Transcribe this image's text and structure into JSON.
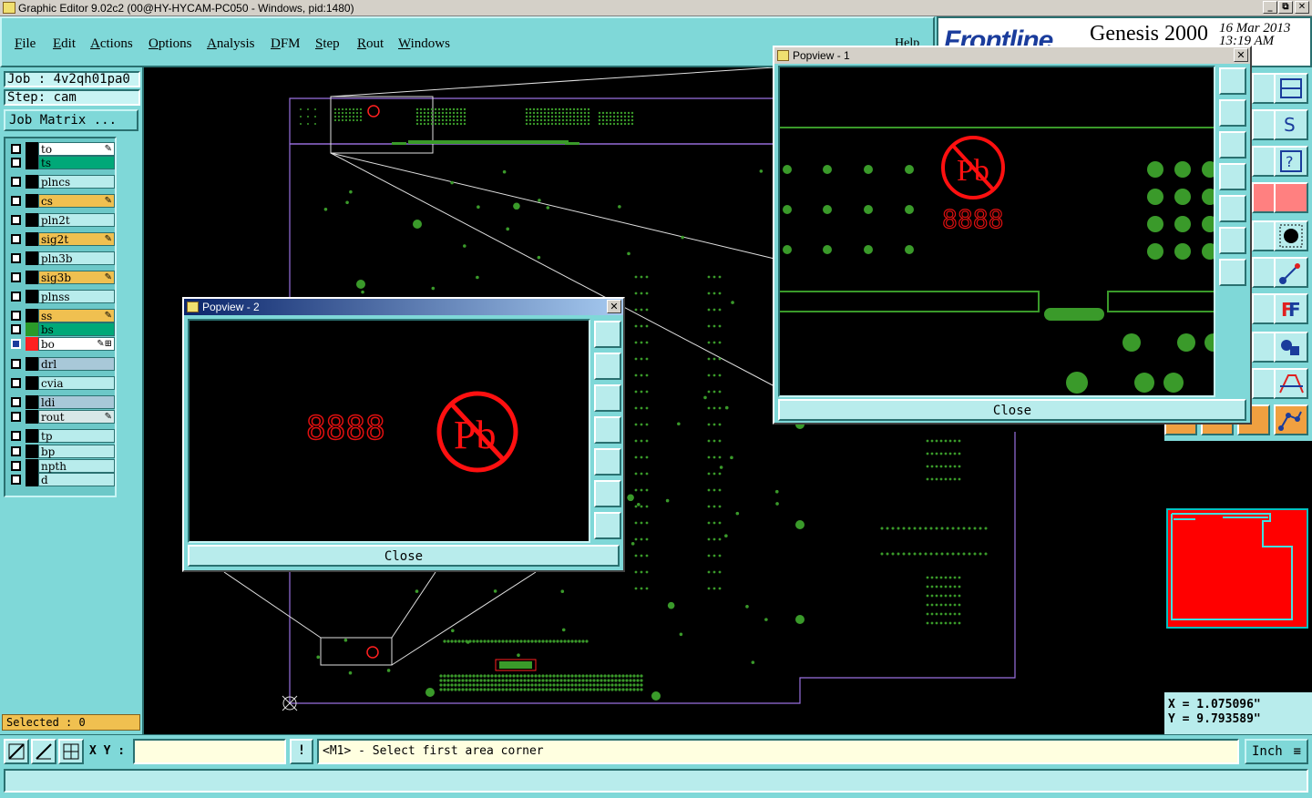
{
  "window": {
    "title": "Graphic Editor 9.02c2 (00@HY-HYCAM-PC050 - Windows, pid:1480)",
    "btn_min": "_",
    "btn_max": "⧉",
    "btn_close": "✕"
  },
  "menu": {
    "items": [
      "File",
      "Edit",
      "Actions",
      "Options",
      "Analysis",
      "DFM",
      "Step",
      "Rout",
      "Windows"
    ],
    "help": "Help"
  },
  "brand": {
    "logo": "Frontline",
    "product": "Genesis 2000",
    "date": "16 Mar 2013",
    "time": "13:19 AM"
  },
  "job": {
    "job_label": "Job : 4v2qh01pa0",
    "step_label": "Step: cam",
    "matrix_button": "Job Matrix ..."
  },
  "layers": [
    {
      "name": "to",
      "bg": "#ffffff",
      "swatch": "#000000",
      "mark": "✎"
    },
    {
      "name": "ts",
      "bg": "#00a878",
      "swatch": "#000000",
      "mark": ""
    },
    {
      "name": "plncs",
      "bg": "#b8ecec",
      "swatch": "#000000",
      "mark": ""
    },
    {
      "name": "cs",
      "bg": "#f0c050",
      "swatch": "#000000",
      "mark": "✎"
    },
    {
      "name": "pln2t",
      "bg": "#b8ecec",
      "swatch": "#000000",
      "mark": ""
    },
    {
      "name": "sig2t",
      "bg": "#f0c050",
      "swatch": "#000000",
      "mark": "✎"
    },
    {
      "name": "pln3b",
      "bg": "#b8ecec",
      "swatch": "#000000",
      "mark": ""
    },
    {
      "name": "sig3b",
      "bg": "#f0c050",
      "swatch": "#000000",
      "mark": "✎"
    },
    {
      "name": "plnss",
      "bg": "#b8ecec",
      "swatch": "#000000",
      "mark": ""
    },
    {
      "name": "ss",
      "bg": "#f0c050",
      "swatch": "#000000",
      "mark": "✎"
    },
    {
      "name": "bs",
      "bg": "#00a878",
      "swatch": "#2a9a2a",
      "mark": ""
    },
    {
      "name": "bo",
      "bg": "#ffffff",
      "swatch": "#ff2020",
      "mark": "✎⊞"
    },
    {
      "name": "drl",
      "bg": "#a8c8d8",
      "swatch": "#000000",
      "mark": ""
    },
    {
      "name": "cvia",
      "bg": "#b8ecec",
      "swatch": "#000000",
      "mark": ""
    },
    {
      "name": "ldi",
      "bg": "#a8c8d8",
      "swatch": "#000000",
      "mark": ""
    },
    {
      "name": "rout",
      "bg": "#d8e8e8",
      "swatch": "#000000",
      "mark": "✎"
    },
    {
      "name": "tp",
      "bg": "#b8ecec",
      "swatch": "#000000",
      "mark": ""
    },
    {
      "name": "bp",
      "bg": "#b8ecec",
      "swatch": "#000000",
      "mark": ""
    },
    {
      "name": "npth",
      "bg": "#b8ecec",
      "swatch": "#000000",
      "mark": ""
    },
    {
      "name": "d",
      "bg": "#b8ecec",
      "swatch": "#000000",
      "mark": ""
    }
  ],
  "selected": "Selected : 0",
  "popview1": {
    "title": "Popview - 1",
    "close": "Close",
    "digits": "8888",
    "symbol": "Pb"
  },
  "popview2": {
    "title": "Popview - 2",
    "close": "Close",
    "digits": "8888",
    "symbol": "Pb"
  },
  "coords": {
    "x": "X = 1.075096\"",
    "y": "Y = 9.793589\""
  },
  "bottom": {
    "xy_label": "X Y :",
    "xy_value": "",
    "excl": "!",
    "prompt": "<M1> - Select first area corner",
    "unit": "Inch"
  },
  "colors": {
    "pad_green": "#3a9a2a",
    "outline": "#9a70e0",
    "accent_red": "#ff0000",
    "panel": "#7fd8d8"
  }
}
